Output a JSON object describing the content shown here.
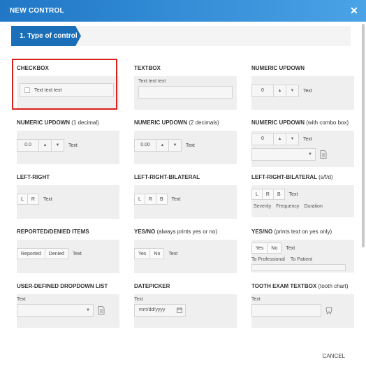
{
  "dialog": {
    "title": "NEW CONTROL",
    "cancel": "CANCEL"
  },
  "step": {
    "label": "1.  Type of control"
  },
  "controls": {
    "checkbox": {
      "title": "CHECKBOX",
      "text": "Text text text"
    },
    "textbox": {
      "title": "TEXTBOX",
      "text": "Text text text"
    },
    "numeric": {
      "title": "NUMERIC UPDOWN",
      "value": "0",
      "text": "Text"
    },
    "numeric1": {
      "title": "NUMERIC UPDOWN",
      "sub": "(1 decimal)",
      "value": "0.0",
      "text": "Text"
    },
    "numeric2": {
      "title": "NUMERIC UPDOWN",
      "sub": "(2 decimals)",
      "value": "0.00",
      "text": "Text"
    },
    "numericCombo": {
      "title": "NUMERIC UPDOWN",
      "sub": "(with combo box)",
      "value": "0",
      "text": "Text"
    },
    "leftRight": {
      "title": "LEFT-RIGHT",
      "l": "L",
      "r": "R",
      "text": "Text"
    },
    "lrBilateral": {
      "title": "LEFT-RIGHT-BILATERAL",
      "l": "L",
      "r": "R",
      "b": "B",
      "text": "Text"
    },
    "lrBilateralSfd": {
      "title": "LEFT-RIGHT-BILATERAL",
      "sub": "(s/f/d)",
      "l": "L",
      "r": "R",
      "b": "B",
      "text": "Text",
      "severity": "Severity",
      "frequency": "Frequency",
      "duration": "Duration"
    },
    "reported": {
      "title": "REPORTED/DENIED ITEMS",
      "reported": "Reported",
      "denied": "Denied",
      "text": "Text"
    },
    "yesno": {
      "title": "YES/NO",
      "sub": "(always prints yes or no)",
      "yes": "Yes",
      "no": "No",
      "text": "Text"
    },
    "yesnoYes": {
      "title": "YES/NO",
      "sub": "(prints text on yes only)",
      "yes": "Yes",
      "no": "No",
      "text": "Text",
      "toProfessional": "To Professional",
      "toPatient": "To Patient"
    },
    "dropdown": {
      "title": "USER-DEFINED DROPDOWN LIST",
      "text": "Text"
    },
    "datepicker": {
      "title": "DATEPICKER",
      "text": "Text",
      "placeholder": "mm/dd/yyyy"
    },
    "tooth": {
      "title": "TOOTH EXAM TEXTBOX",
      "sub": "(tooth chart)",
      "text": "Text"
    }
  },
  "colors": {
    "accent": "#1b6fb8",
    "highlight": "#d8201d"
  }
}
